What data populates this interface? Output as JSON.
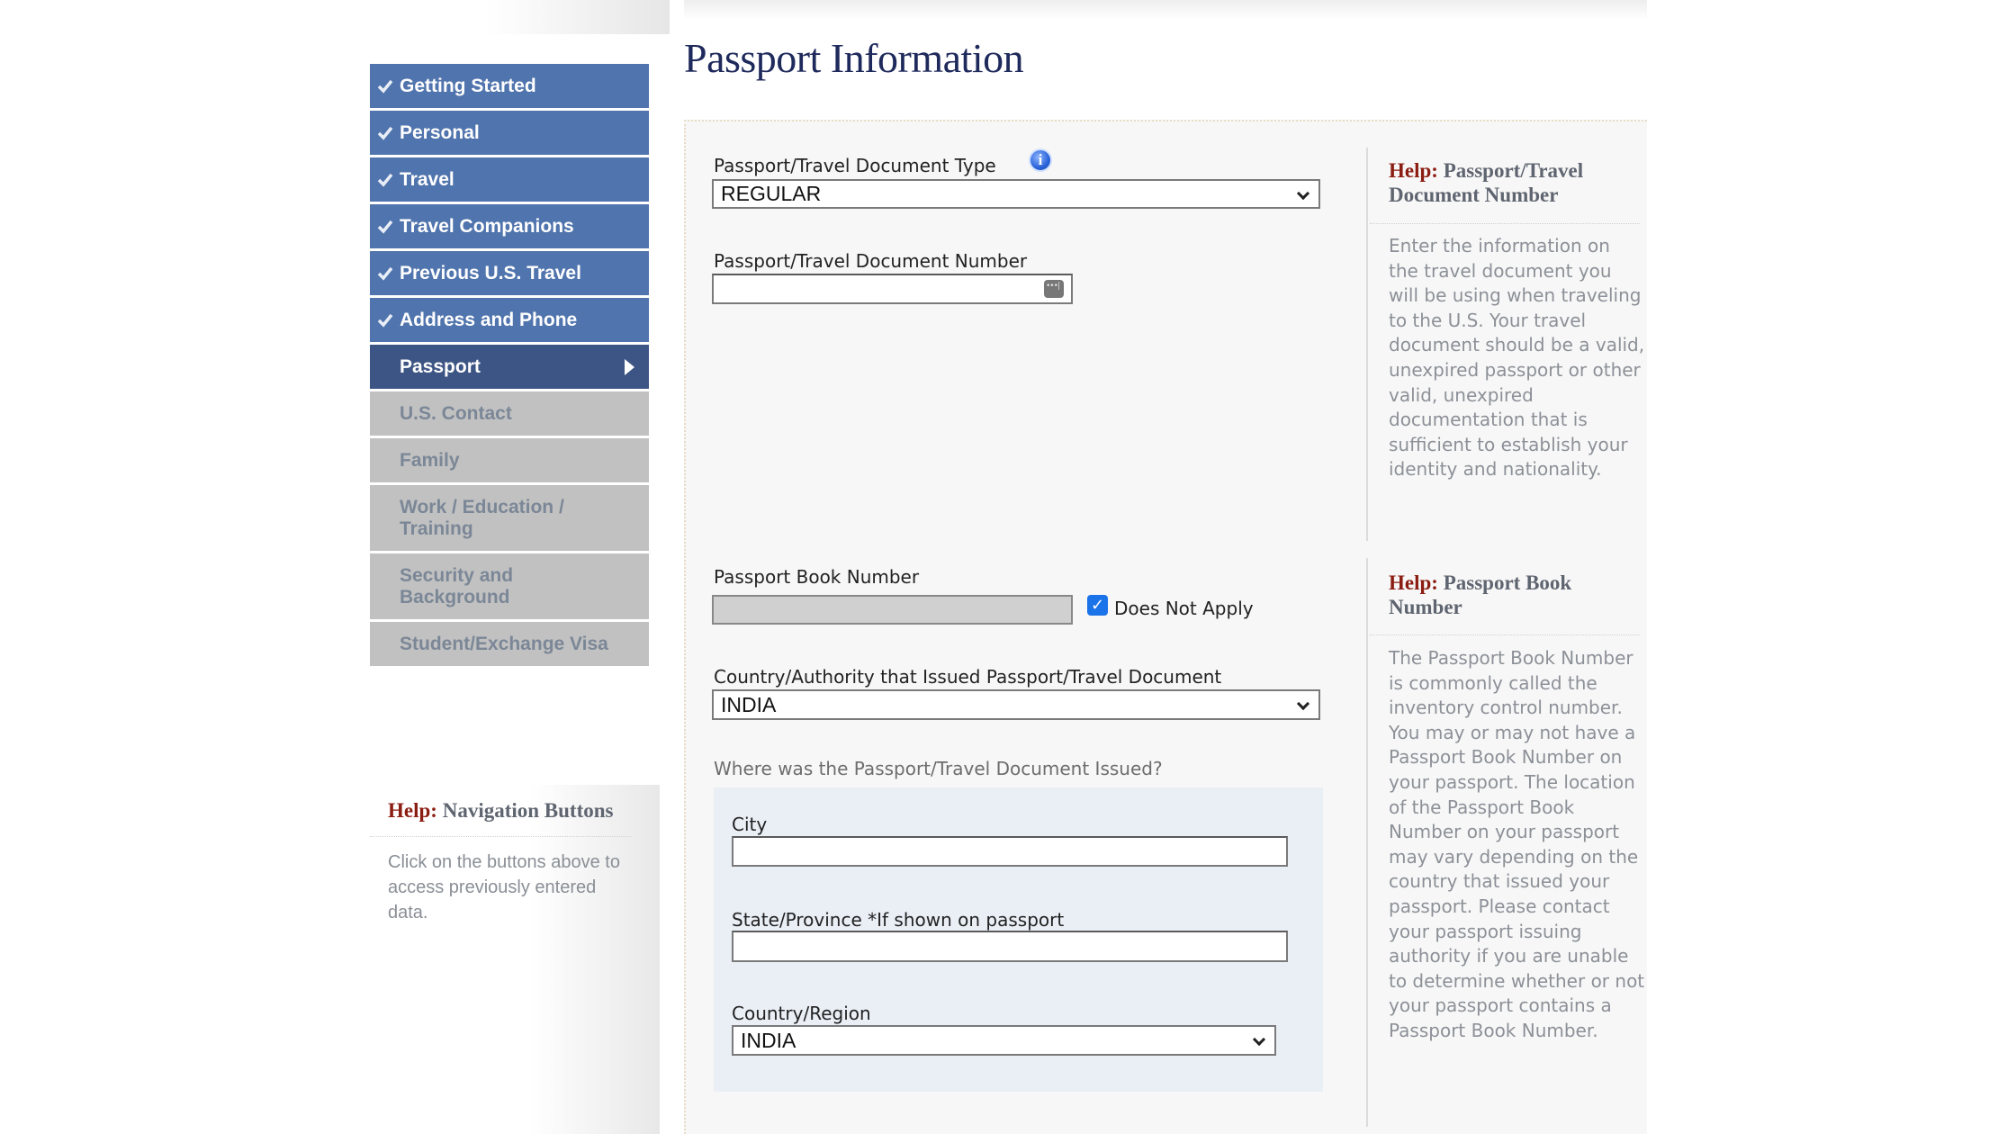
{
  "page_title": "Passport Information",
  "nav": {
    "items": [
      {
        "label": "Getting Started",
        "state": "done"
      },
      {
        "label": "Personal",
        "state": "done"
      },
      {
        "label": "Travel",
        "state": "done"
      },
      {
        "label": "Travel Companions",
        "state": "done"
      },
      {
        "label": "Previous U.S. Travel",
        "state": "done"
      },
      {
        "label": "Address and Phone",
        "state": "done"
      },
      {
        "label": "Passport",
        "state": "active"
      },
      {
        "label": "U.S. Contact",
        "state": "todo"
      },
      {
        "label": "Family",
        "state": "todo"
      },
      {
        "label": "Work / Education / Training",
        "state": "todo"
      },
      {
        "label": "Security and Background",
        "state": "todo"
      },
      {
        "label": "Student/Exchange Visa",
        "state": "todo"
      }
    ]
  },
  "left_help": {
    "help_word": "Help:",
    "title": " Navigation Buttons",
    "body": "Click on the buttons above to access previously entered data."
  },
  "form": {
    "doc_type": {
      "label": "Passport/Travel Document Type",
      "value": "REGULAR",
      "info_icon": "info-icon"
    },
    "doc_number": {
      "label": "Passport/Travel Document Number",
      "value": ""
    },
    "book_number": {
      "label": "Passport Book Number",
      "value": "",
      "does_not_apply_label": "Does Not Apply",
      "does_not_apply_checked": true
    },
    "issuing_country": {
      "label": "Country/Authority that Issued Passport/Travel Document",
      "value": "INDIA"
    },
    "issued_where": {
      "heading": "Where was the Passport/Travel Document Issued?",
      "city": {
        "label": "City",
        "value": ""
      },
      "state": {
        "label": "State/Province *If shown on passport",
        "value": ""
      },
      "country": {
        "label": "Country/Region",
        "value": "INDIA"
      }
    }
  },
  "right_help": [
    {
      "help_word": "Help:",
      "title": " Passport/Travel Document Number",
      "body": "Enter the information on the travel document you will be using when traveling to the U.S. Your travel document should be a valid, unexpired passport or other valid, unexpired documentation that is sufficient to establish your identity and nationality."
    },
    {
      "help_word": "Help:",
      "title": " Passport Book Number",
      "body": "The Passport Book Number is commonly called the inventory control number. You may or may not have a Passport Book Number on your passport. The location of the Passport Book Number on your passport may vary depending on the country that issued your passport. Please contact your passport issuing authority if you are unable to determine whether or not your passport contains a Passport Book Number."
    }
  ],
  "colors": {
    "nav_done": "#5074ad",
    "nav_active": "#3d5585",
    "nav_todo": "#c1c1c1",
    "help_word": "#8b1d12",
    "title": "#1f2a5c"
  }
}
